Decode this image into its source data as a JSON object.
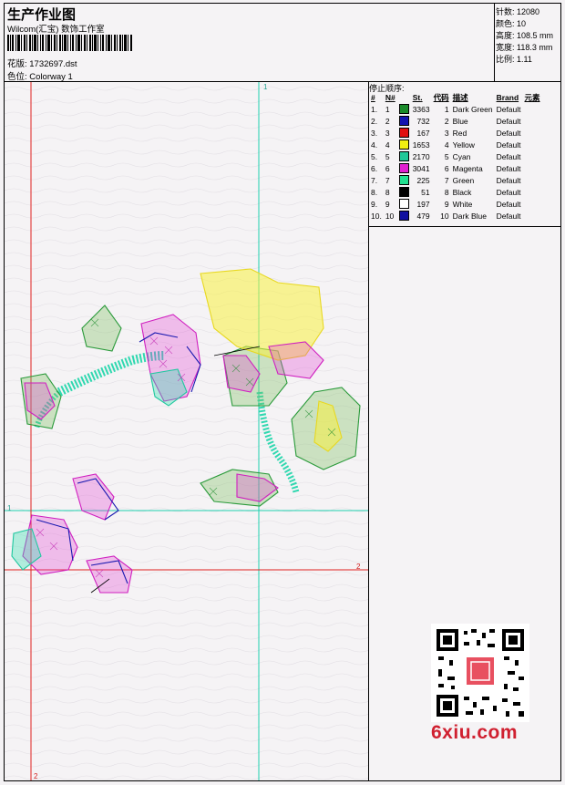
{
  "header": {
    "title": "生产作业图",
    "company": "Wilcom(汇宝) 数饰工作室",
    "design_label": "花版: 1732697.dst",
    "colorway_label": "色位:  Colorway 1"
  },
  "stats": {
    "stitches": "针数: 12080",
    "colors": "颜色: 10",
    "height": "高度: 108.5 mm",
    "width": "宽度: 118.3 mm",
    "scale": "比例: 1.11"
  },
  "stop_sequence": {
    "title": "停止顺序:",
    "headers": [
      "#",
      "N#",
      "",
      "St.",
      "代码",
      "描述",
      "Brand",
      "元素"
    ],
    "rows": [
      {
        "n": "1.",
        "no": "1",
        "color": "#1a8a2a",
        "st": "3363",
        "code": "1",
        "desc": "Dark Green",
        "brand": "Default"
      },
      {
        "n": "2.",
        "no": "2",
        "color": "#1414b0",
        "st": "732",
        "code": "2",
        "desc": "Blue",
        "brand": "Default"
      },
      {
        "n": "3.",
        "no": "3",
        "color": "#e01010",
        "st": "167",
        "code": "3",
        "desc": "Red",
        "brand": "Default"
      },
      {
        "n": "4.",
        "no": "4",
        "color": "#f0f010",
        "st": "1653",
        "code": "4",
        "desc": "Yellow",
        "brand": "Default"
      },
      {
        "n": "5.",
        "no": "5",
        "color": "#20c898",
        "st": "2170",
        "code": "5",
        "desc": "Cyan",
        "brand": "Default"
      },
      {
        "n": "6.",
        "no": "6",
        "color": "#e020d0",
        "st": "3041",
        "code": "6",
        "desc": "Magenta",
        "brand": "Default"
      },
      {
        "n": "7.",
        "no": "7",
        "color": "#20e090",
        "st": "225",
        "code": "7",
        "desc": "Green",
        "brand": "Default"
      },
      {
        "n": "8.",
        "no": "8",
        "color": "#000000",
        "st": "51",
        "code": "8",
        "desc": "Black",
        "brand": "Default"
      },
      {
        "n": "9.",
        "no": "9",
        "color": "#ffffff",
        "st": "197",
        "code": "9",
        "desc": "White",
        "brand": "Default"
      },
      {
        "n": "10.",
        "no": "10",
        "color": "#1010a0",
        "st": "479",
        "code": "10",
        "desc": "Dark Blue",
        "brand": "Default"
      }
    ]
  },
  "guides": {
    "v1_label": "1",
    "h1_label": "1",
    "h2_label": "2",
    "v2_label": "2"
  },
  "watermark": "6xiu.com",
  "colors": {
    "guide_cyan": "#20d0b0",
    "guide_red": "#e02020"
  }
}
